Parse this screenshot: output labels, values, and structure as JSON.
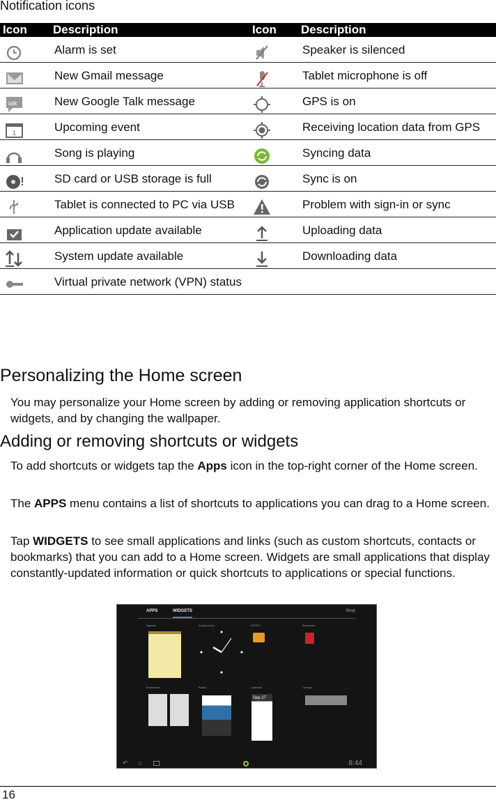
{
  "caption": "Notification icons",
  "table": {
    "headers": [
      "Icon",
      "Description",
      "Icon",
      "Description"
    ],
    "rows": [
      [
        "alarm-icon",
        "Alarm is set",
        "speaker-silenced-icon",
        "Speaker is silenced"
      ],
      [
        "gmail-icon",
        "New Gmail message",
        "microphone-off-icon",
        "Tablet microphone is off"
      ],
      [
        "talk-icon",
        "New Google Talk message",
        "gps-icon",
        "GPS is on"
      ],
      [
        "calendar-icon",
        "Upcoming event",
        "gps-receiving-icon",
        "Receiving location data from GPS"
      ],
      [
        "headphones-icon",
        "Song is playing",
        "sync-active-icon",
        "Syncing data"
      ],
      [
        "sd-card-full-icon",
        "SD card or USB storage is full",
        "sync-icon",
        "Sync is on"
      ],
      [
        "usb-icon",
        "Tablet is connected to PC via USB",
        "warning-icon",
        "Problem with sign-in or sync"
      ],
      [
        "app-update-icon",
        "Application update available",
        "upload-icon",
        "Uploading data"
      ],
      [
        "system-update-icon",
        "System update available",
        "download-icon",
        "Downloading data"
      ],
      [
        "vpn-key-icon",
        "Virtual private network (VPN) status",
        "",
        ""
      ]
    ]
  },
  "sections": {
    "h1": "Personalizing the Home screen",
    "p1": "You may personalize your Home screen by adding or removing application shortcuts or widgets, and by changing the wallpaper.",
    "h2": "Adding or removing shortcuts or widgets",
    "p2": [
      "To add shortcuts or widgets tap the ",
      "Apps",
      " icon in the top-right corner of the Home screen."
    ],
    "p3": [
      "The ",
      "APPS",
      " menu contains a list of shortcuts to applications you can drag to a Home screen."
    ],
    "p4": [
      "Tap ",
      "WIDGETS",
      " to see small applications and links (such as custom shortcuts, contacts or bookmarks) that you can add to a Home screen. Widgets are small applications that display constantly-updated information or quick shortcuts to applications or special functions."
    ]
  },
  "screenshot": {
    "tabs": [
      "APPS",
      "WIDGETS"
    ],
    "shop": "Shop",
    "widgets": [
      "Agenda",
      "Analog clock",
      "ASTRO",
      "Bookmark",
      "Bookmarks",
      "Books",
      "Calendar",
      "Contact"
    ],
    "calendar_date": "Sep 27",
    "clock": "8:44"
  },
  "page_number": "16",
  "colors": {
    "sync_green": "#7bb83a",
    "mic_red": "#d22"
  }
}
